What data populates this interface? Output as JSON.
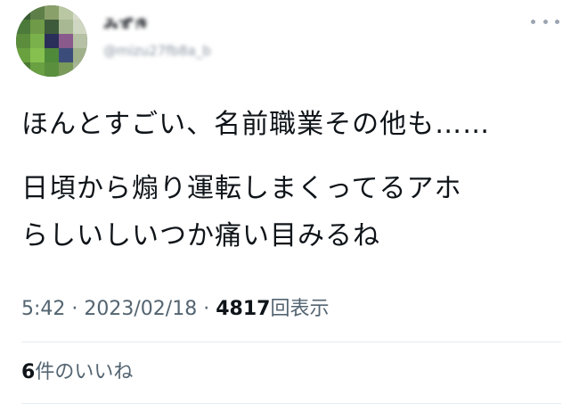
{
  "user": {
    "display_name": "みずき",
    "handle": "@mizu27fb8a_b"
  },
  "tweet": {
    "lines": [
      "ほんとすごい、名前職業その他も……",
      "日頃から煽り運転しまくってるアホ",
      "らしいしいつか痛い目みるね"
    ],
    "time": "5:42",
    "separator": "·",
    "date": "2023/02/18",
    "views_count": "4817",
    "views_label": "回表示"
  },
  "engagement": {
    "likes_count": "6",
    "likes_label": "件のいいね"
  },
  "icons": {
    "more": "more-dots-icon"
  },
  "colors": {
    "text": "#0f1419",
    "secondary": "#536471",
    "divider": "#e6ecf0"
  }
}
